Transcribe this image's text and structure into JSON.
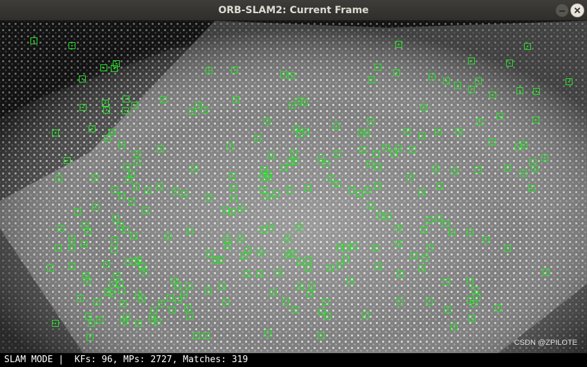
{
  "window": {
    "title": "ORB-SLAM2: Current Frame",
    "buttons": [
      "minimize",
      "close"
    ]
  },
  "frame": {
    "watermark": "CSDN @ZPILOTE",
    "keypoint_color": "#1ee61e",
    "icon_names": [
      "keypoint-marker-icon"
    ]
  },
  "status": {
    "text": "SLAM MODE |  KFs: 96, MPs: 2727, Matches: 319"
  }
}
